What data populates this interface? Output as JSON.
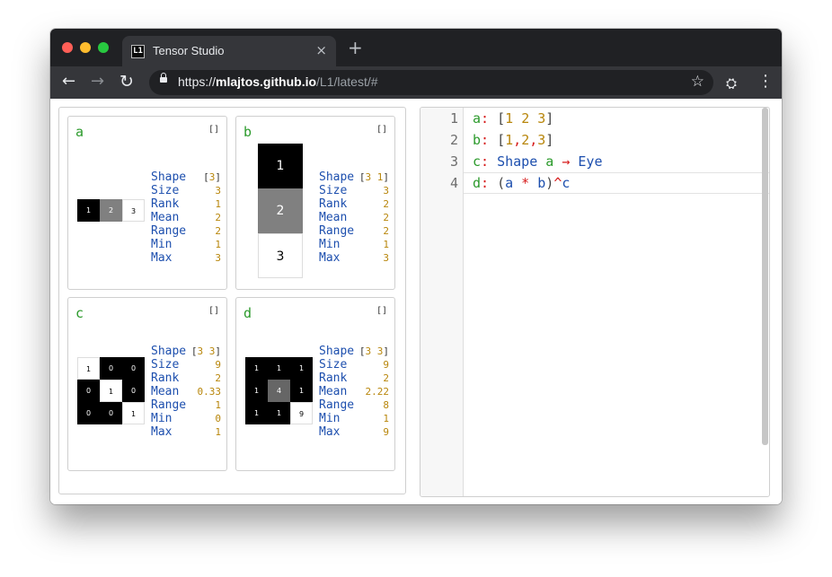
{
  "browser": {
    "tab_title": "Tensor Studio",
    "favicon_text": "L1",
    "tab_close": "×",
    "new_tab": "+",
    "url_scheme": "https://",
    "url_host": "mlajtos.github.io",
    "url_path": "/L1/latest/#",
    "back_glyph": "←",
    "forward_glyph": "→",
    "reload_glyph": "↻",
    "star_glyph": "☆",
    "menu_glyph": "⋮",
    "extension_glyph": "⛭"
  },
  "colors": {
    "name_green": "#2b9a2b",
    "key_blue": "#1d4fae",
    "number_gold": "#b8860b",
    "operator_red": "#d61a1a"
  },
  "stat_labels": [
    "Shape",
    "Size",
    "Rank",
    "Mean",
    "Range",
    "Min",
    "Max"
  ],
  "cards": [
    {
      "name": "a",
      "bracket": "[]",
      "shape_open": "[",
      "shape_nums": "3",
      "shape_close": "]",
      "stats": [
        "3",
        "1",
        "2",
        "2",
        "1",
        "3"
      ],
      "cells": [
        [
          {
            "v": "1",
            "level": 0
          },
          {
            "v": "2",
            "level": 0.5
          },
          {
            "v": "3",
            "level": 1
          }
        ]
      ]
    },
    {
      "name": "b",
      "bracket": "[]",
      "shape_open": "[",
      "shape_nums": "3 1",
      "shape_close": "]",
      "stats": [
        "3",
        "2",
        "2",
        "2",
        "1",
        "3"
      ],
      "cells": [
        [
          {
            "v": "1",
            "level": 0
          }
        ],
        [
          {
            "v": "2",
            "level": 0.5
          }
        ],
        [
          {
            "v": "3",
            "level": 1
          }
        ]
      ]
    },
    {
      "name": "c",
      "bracket": "[]",
      "shape_open": "[",
      "shape_nums": "3 3",
      "shape_close": "]",
      "stats": [
        "9",
        "2",
        "0.33",
        "1",
        "0",
        "1"
      ],
      "cells": [
        [
          {
            "v": "1",
            "level": 1
          },
          {
            "v": "0",
            "level": 0
          },
          {
            "v": "0",
            "level": 0
          }
        ],
        [
          {
            "v": "0",
            "level": 0
          },
          {
            "v": "1",
            "level": 1
          },
          {
            "v": "0",
            "level": 0
          }
        ],
        [
          {
            "v": "0",
            "level": 0
          },
          {
            "v": "0",
            "level": 0
          },
          {
            "v": "1",
            "level": 1
          }
        ]
      ]
    },
    {
      "name": "d",
      "bracket": "[]",
      "shape_open": "[",
      "shape_nums": "3 3",
      "shape_close": "]",
      "stats": [
        "9",
        "2",
        "2.22",
        "8",
        "1",
        "9"
      ],
      "cells": [
        [
          {
            "v": "1",
            "level": 0
          },
          {
            "v": "1",
            "level": 0
          },
          {
            "v": "1",
            "level": 0
          }
        ],
        [
          {
            "v": "1",
            "level": 0
          },
          {
            "v": "4",
            "level": 0.4
          },
          {
            "v": "1",
            "level": 0
          }
        ],
        [
          {
            "v": "1",
            "level": 0
          },
          {
            "v": "1",
            "level": 0
          },
          {
            "v": "9",
            "level": 1
          }
        ]
      ]
    }
  ],
  "editor": {
    "line_numbers": [
      "1",
      "2",
      "3",
      "4"
    ],
    "lines": [
      [
        {
          "t": "a",
          "c": "g"
        },
        {
          "t": ": ",
          "c": "r"
        },
        {
          "t": "[",
          "c": "br2"
        },
        {
          "t": "1",
          "c": "n"
        },
        {
          "t": " ",
          "c": ""
        },
        {
          "t": "2",
          "c": "n"
        },
        {
          "t": " ",
          "c": ""
        },
        {
          "t": "3",
          "c": "n"
        },
        {
          "t": "]",
          "c": "br2"
        }
      ],
      [
        {
          "t": "b",
          "c": "g"
        },
        {
          "t": ": ",
          "c": "r"
        },
        {
          "t": "[",
          "c": "br2"
        },
        {
          "t": "1",
          "c": "n"
        },
        {
          "t": ",",
          "c": "r"
        },
        {
          "t": "2",
          "c": "n"
        },
        {
          "t": ",",
          "c": "r"
        },
        {
          "t": "3",
          "c": "n"
        },
        {
          "t": "]",
          "c": "br2"
        }
      ],
      [
        {
          "t": "c",
          "c": "g"
        },
        {
          "t": ": ",
          "c": "r"
        },
        {
          "t": "Shape",
          "c": "bl"
        },
        {
          "t": " ",
          "c": ""
        },
        {
          "t": "a",
          "c": "g"
        },
        {
          "t": " → ",
          "c": "r"
        },
        {
          "t": "Eye",
          "c": "bl"
        }
      ],
      [
        {
          "t": "d",
          "c": "g"
        },
        {
          "t": ": ",
          "c": "r"
        },
        {
          "t": "(",
          "c": "br2"
        },
        {
          "t": "a",
          "c": "bl"
        },
        {
          "t": " * ",
          "c": "r"
        },
        {
          "t": "b",
          "c": "bl"
        },
        {
          "t": ")",
          "c": "br2"
        },
        {
          "t": "^",
          "c": "r"
        },
        {
          "t": "c",
          "c": "bl"
        }
      ]
    ]
  }
}
